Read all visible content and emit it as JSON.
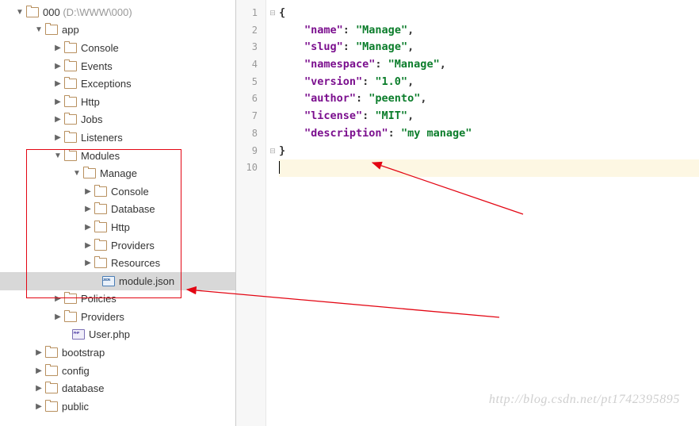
{
  "tree": {
    "root": {
      "label": "000",
      "suffix": " (D:\\WWW\\000)"
    },
    "app": {
      "label": "app"
    },
    "console": {
      "label": "Console"
    },
    "events": {
      "label": "Events"
    },
    "exceptions": {
      "label": "Exceptions"
    },
    "http": {
      "label": "Http"
    },
    "jobs": {
      "label": "Jobs"
    },
    "listeners": {
      "label": "Listeners"
    },
    "modules": {
      "label": "Modules"
    },
    "manage": {
      "label": "Manage"
    },
    "m_console": {
      "label": "Console"
    },
    "m_database": {
      "label": "Database"
    },
    "m_http": {
      "label": "Http"
    },
    "m_providers": {
      "label": "Providers"
    },
    "m_resources": {
      "label": "Resources"
    },
    "modulejson": {
      "label": "module.json"
    },
    "policies": {
      "label": "Policies"
    },
    "providers": {
      "label": "Providers"
    },
    "userphp": {
      "label": "User.php"
    },
    "bootstrap": {
      "label": "bootstrap"
    },
    "config": {
      "label": "config"
    },
    "database": {
      "label": "database"
    },
    "public": {
      "label": "public"
    }
  },
  "editor": {
    "lines": {
      "l1": "{",
      "l2k": "\"name\"",
      "l2v": "\"Manage\"",
      "l3k": "\"slug\"",
      "l3v": "\"Manage\"",
      "l4k": "\"namespace\"",
      "l4v": "\"Manage\"",
      "l5k": "\"version\"",
      "l5v": "\"1.0\"",
      "l6k": "\"author\"",
      "l6v": "\"peento\"",
      "l7k": "\"license\"",
      "l7v": "\"MIT\"",
      "l8k": "\"description\"",
      "l8v": "\"my manage\"",
      "l9": "}"
    },
    "linenums": [
      "1",
      "2",
      "3",
      "4",
      "5",
      "6",
      "7",
      "8",
      "9",
      "10"
    ]
  },
  "watermark": "http://blog.csdn.net/pt1742395895",
  "chart_data": {
    "type": "table",
    "title": "module.json",
    "rows": [
      {
        "key": "name",
        "value": "Manage"
      },
      {
        "key": "slug",
        "value": "Manage"
      },
      {
        "key": "namespace",
        "value": "Manage"
      },
      {
        "key": "version",
        "value": "1.0"
      },
      {
        "key": "author",
        "value": "peento"
      },
      {
        "key": "license",
        "value": "MIT"
      },
      {
        "key": "description",
        "value": "my manage"
      }
    ]
  }
}
